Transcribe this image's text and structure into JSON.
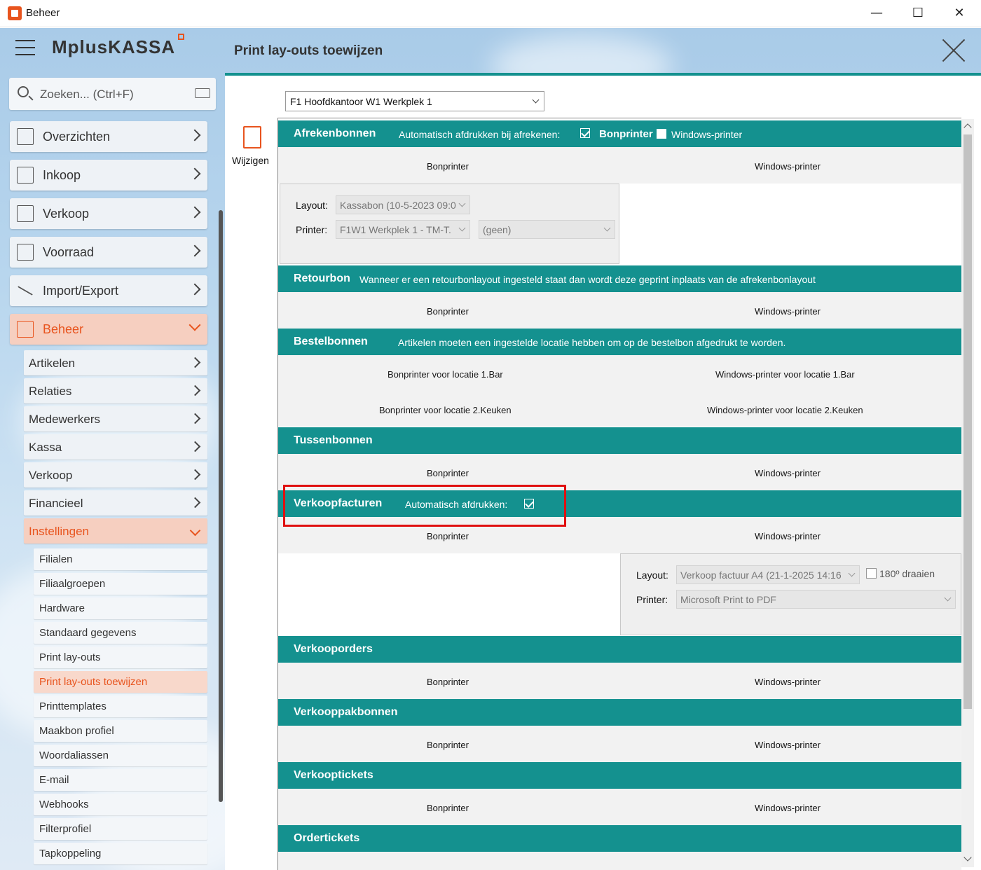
{
  "window": {
    "title": "Beheer"
  },
  "sidebar": {
    "logo": "MplusKASSA",
    "search_placeholder": "Zoeken... (Ctrl+F)",
    "nav": [
      {
        "label": "Overzichten"
      },
      {
        "label": "Inkoop"
      },
      {
        "label": "Verkoop"
      },
      {
        "label": "Voorraad"
      },
      {
        "label": "Import/Export"
      },
      {
        "label": "Beheer"
      }
    ],
    "sub": [
      {
        "label": "Artikelen"
      },
      {
        "label": "Relaties"
      },
      {
        "label": "Medewerkers"
      },
      {
        "label": "Kassa"
      },
      {
        "label": "Verkoop"
      },
      {
        "label": "Financieel"
      },
      {
        "label": "Instellingen"
      }
    ],
    "sub2": [
      {
        "label": "Filialen"
      },
      {
        "label": "Filiaalgroepen"
      },
      {
        "label": "Hardware"
      },
      {
        "label": "Standaard gegevens"
      },
      {
        "label": "Print lay-outs"
      },
      {
        "label": "Print lay-outs toewijzen"
      },
      {
        "label": "Printtemplates"
      },
      {
        "label": "Maakbon profiel"
      },
      {
        "label": "Woordaliassen"
      },
      {
        "label": "E-mail"
      },
      {
        "label": "Webhooks"
      },
      {
        "label": "Filterprofiel"
      },
      {
        "label": "Tapkoppeling"
      }
    ]
  },
  "header": {
    "title": "Print lay-outs toewijzen"
  },
  "location_select": {
    "value": "F1 Hoofdkantoor W1 Werkplek 1"
  },
  "toolbar": {
    "edit_label": "Wijzigen"
  },
  "sections": {
    "afreken": {
      "title": "Afrekenbonnen",
      "auto_label": "Automatisch afdrukken bij afrekenen:",
      "bonprinter_label": "Bonprinter",
      "windows_label": "Windows-printer",
      "col1": "Bonprinter",
      "col2": "Windows-printer",
      "layout_label": "Layout:",
      "layout_value": "Kassabon (10-5-2023 09:0",
      "printer_label": "Printer:",
      "printer_value": "F1W1 Werkplek 1 - TM-T.",
      "printer2_value": "(geen)"
    },
    "retour": {
      "title": "Retourbon",
      "note": "Wanneer er een retourbonlayout ingesteld staat dan wordt deze geprint inplaats van de afrekenbonlayout",
      "col1": "Bonprinter",
      "col2": "Windows-printer"
    },
    "bestel": {
      "title": "Bestelbonnen",
      "note": "Artikelen moeten een ingestelde locatie hebben om op de bestelbon afgedrukt te worden.",
      "r1c1": "Bonprinter voor locatie 1.Bar",
      "r1c2": "Windows-printer voor locatie 1.Bar",
      "r2c1": "Bonprinter voor locatie 2.Keuken",
      "r2c2": "Windows-printer voor locatie 2.Keuken"
    },
    "tussen": {
      "title": "Tussenbonnen",
      "col1": "Bonprinter",
      "col2": "Windows-printer"
    },
    "factuur": {
      "title": "Verkoopfacturen",
      "auto_label": "Automatisch afdrukken:",
      "col1": "Bonprinter",
      "col2": "Windows-printer",
      "layout_label": "Layout:",
      "layout_value": "Verkoop factuur A4 (21-1-2025 14:16",
      "rotate_label": "180º draaien",
      "printer_label": "Printer:",
      "printer_value": "Microsoft Print to PDF"
    },
    "orders": {
      "title": "Verkooporders",
      "col1": "Bonprinter",
      "col2": "Windows-printer"
    },
    "pakbon": {
      "title": "Verkooppakbonnen",
      "col1": "Bonprinter",
      "col2": "Windows-printer"
    },
    "tickets": {
      "title": "Verkooptickets",
      "col1": "Bonprinter",
      "col2": "Windows-printer"
    },
    "ordert": {
      "title": "Ordertickets"
    }
  },
  "colors": {
    "accent": "#e8541e",
    "teal": "#14918f",
    "highlight": "#e01010"
  }
}
